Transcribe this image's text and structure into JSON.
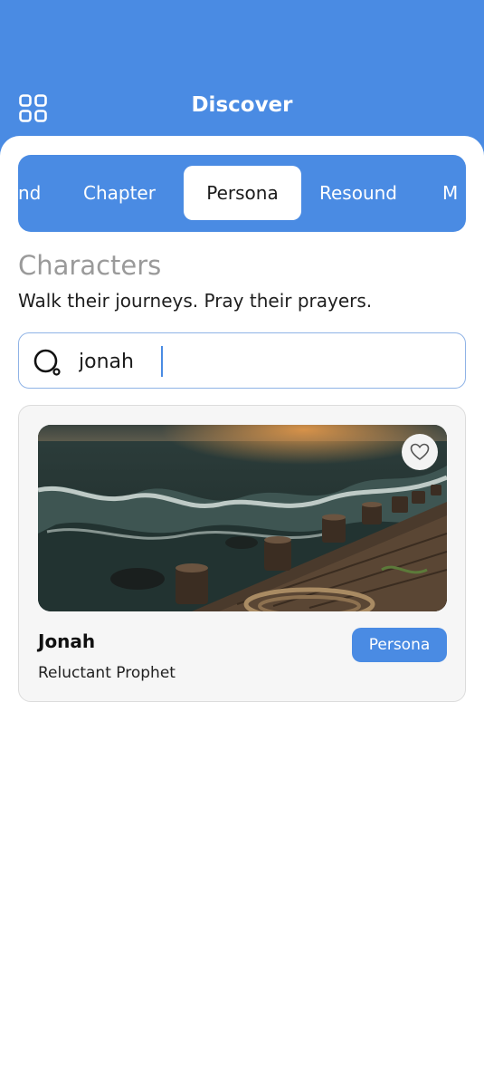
{
  "header": {
    "title": "Discover",
    "menu_icon": "grid-icon",
    "color": "#4a8be3"
  },
  "tabs": [
    {
      "label": "nd"
    },
    {
      "label": "Chapter"
    },
    {
      "label": "Persona",
      "active": true
    },
    {
      "label": "Resound"
    },
    {
      "label": "M"
    }
  ],
  "section": {
    "title": "Characters",
    "subtitle": "Walk their journeys. Pray their prayers."
  },
  "search": {
    "value": "jonah",
    "icon": "search-icon"
  },
  "results": [
    {
      "name": "Jonah",
      "role": "Reluctant Prophet",
      "badge": "Persona",
      "favorite_icon": "heart-icon"
    }
  ]
}
